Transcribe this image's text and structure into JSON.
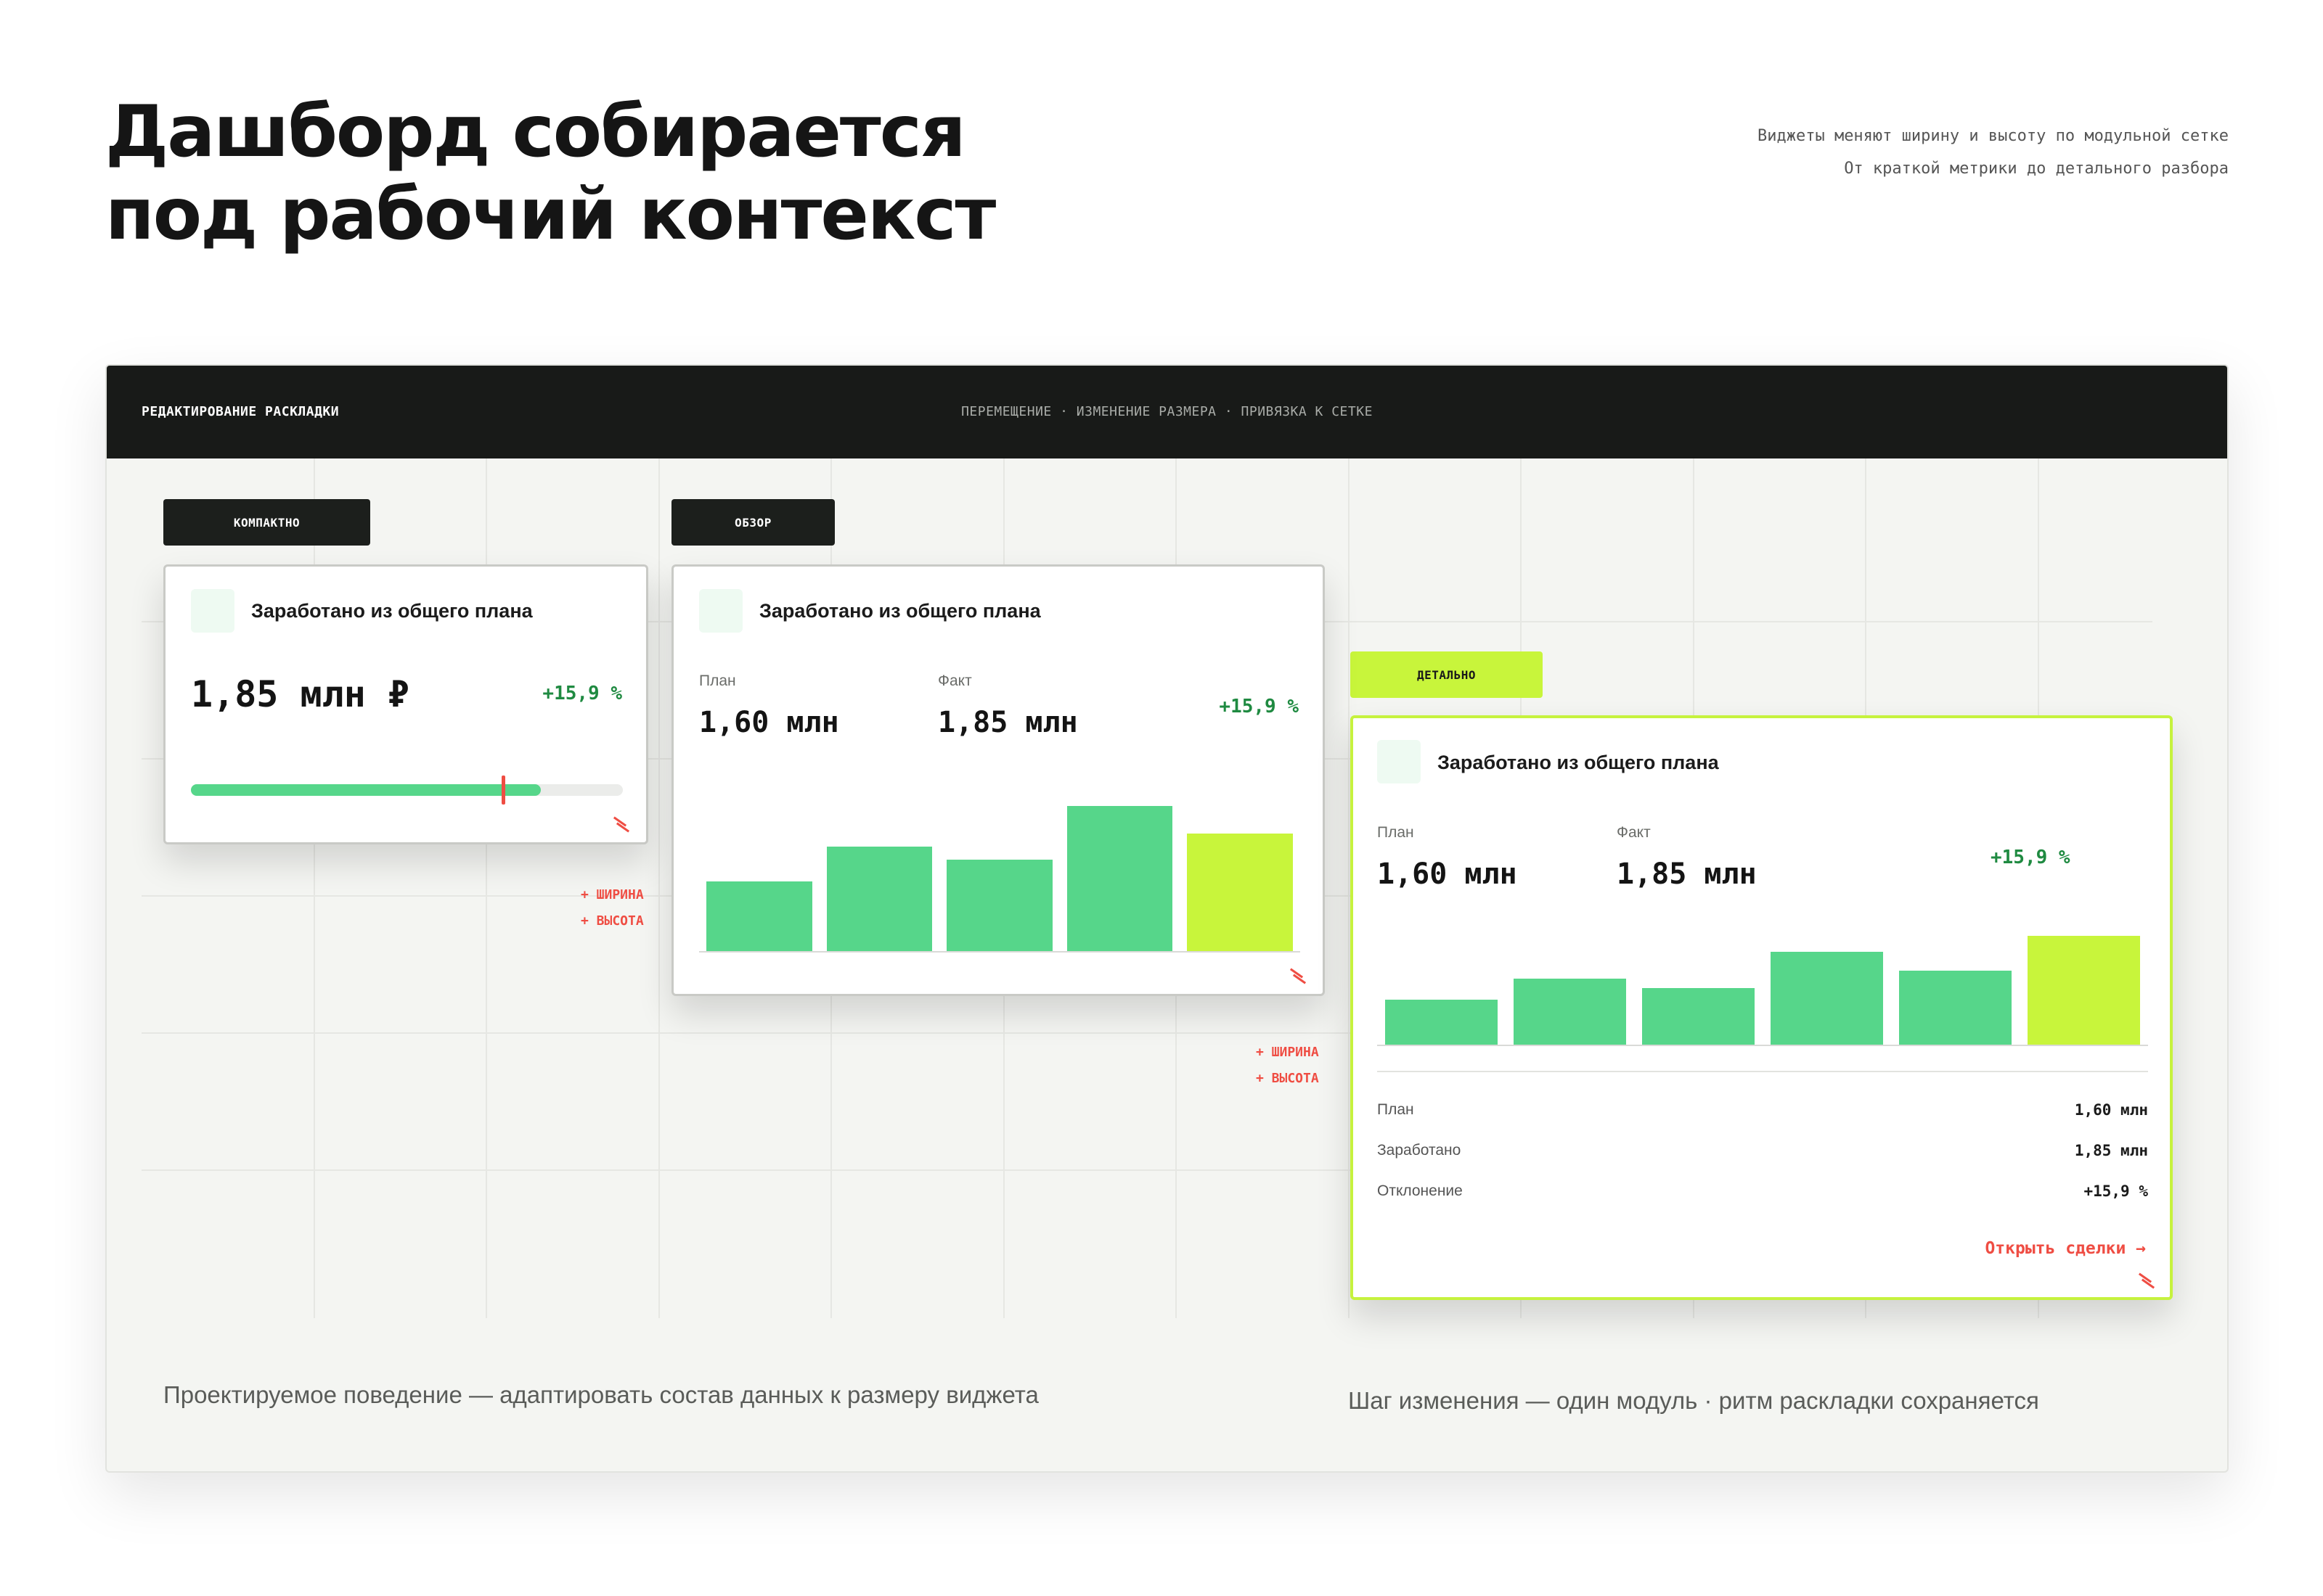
{
  "header": {
    "title_lines": [
      "Дашборд собирается",
      "под рабочий контекст"
    ],
    "subtitle_lines": [
      "Виджеты меняют ширину и высоту по модульной сетке",
      "От краткой метрики до детального разбора"
    ]
  },
  "toolbar": {
    "left_label": "РЕДАКТИРОВАНИЕ РАСКЛАДКИ",
    "center_label": "ПЕРЕМЕЩЕНИЕ · ИЗМЕНЕНИЕ РАЗМЕРА · ПРИВЯЗКА К СЕТКЕ"
  },
  "tags": {
    "compact": "КОМПАКТНО",
    "overview": "ОБЗОР",
    "detailed": "ДЕТАЛЬНО"
  },
  "colors": {
    "accent_lime": "#c8f53b",
    "bar_green": "#56d68a",
    "delta_green": "#1f8a41",
    "handle_red": "#ef4d43"
  },
  "compact_widget": {
    "title": "Заработано из общего плана",
    "value": "1,85 млн ₽",
    "delta": "+15,9 %",
    "progress_fraction": 0.81,
    "plan_marker_fraction": 0.72
  },
  "overview_widget": {
    "title": "Заработано из общего плана",
    "plan_label": "План",
    "plan_value": "1,60 млн",
    "fact_label": "Факт",
    "fact_value": "1,85 млн",
    "delta": "+15,9 %",
    "bar_values": [
      48,
      72,
      63,
      100,
      81
    ]
  },
  "detailed_widget": {
    "title": "Заработано из общего плана",
    "plan_label": "План",
    "plan_value": "1,60 млн",
    "fact_label": "Факт",
    "fact_value": "1,85 млн",
    "delta": "+15,9 %",
    "bar_values": [
      40,
      58,
      50,
      82,
      65,
      96
    ],
    "stats": [
      {
        "label": "План",
        "value": "1,60 млн"
      },
      {
        "label": "Заработано",
        "value": "1,85 млн"
      },
      {
        "label": "Отклонение",
        "value": "+15,9 %"
      }
    ],
    "link": "Открыть сделки →"
  },
  "annotations": {
    "width": "+ ШИРИНА",
    "height": "+ ВЫСОТА"
  },
  "captions": {
    "left": "Проектируемое поведение — адаптировать состав данных к размеру виджета",
    "right": "Шаг изменения — один модуль · ритм раскладки сохраняется"
  }
}
